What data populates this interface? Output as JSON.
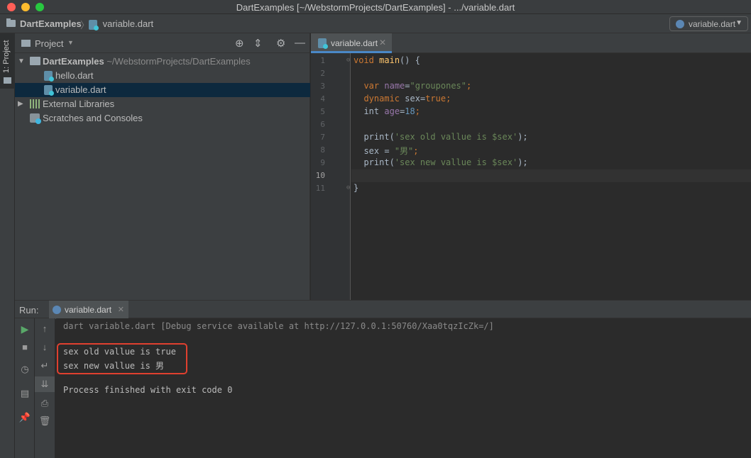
{
  "window": {
    "title": "DartExamples [~/WebstormProjects/DartExamples] - .../variable.dart"
  },
  "navbar": {
    "project": "DartExamples",
    "file": "variable.dart",
    "run_config": "variable.dart"
  },
  "left_strip": {
    "project_tab": "1: Project"
  },
  "project_panel": {
    "title": "Project",
    "tree": [
      {
        "label": "DartExamples",
        "path": "~/WebstormProjects/DartExamples"
      },
      {
        "label": "hello.dart"
      },
      {
        "label": "variable.dart",
        "selected": true
      },
      {
        "label": "External Libraries"
      },
      {
        "label": "Scratches and Consoles"
      }
    ]
  },
  "editor": {
    "tab": "variable.dart",
    "line_numbers": [
      "1",
      "2",
      "3",
      "4",
      "5",
      "6",
      "7",
      "8",
      "9",
      "10",
      "11"
    ],
    "current_line": "10",
    "code": {
      "l1_kw": "void",
      "l1_fn": "main",
      "l1_rest": "() {",
      "l3_kw": "var",
      "l3_name": "name",
      "l3_eq": "=",
      "l3_str": "\"groupones\"",
      "l3_end": ";",
      "l4_kw": "dynamic",
      "l4_name": "sex",
      "l4_eq": "=",
      "l4_val": "true",
      "l4_end": ";",
      "l5_kw": "int",
      "l5_name": "age",
      "l5_eq": "=",
      "l5_val": "18",
      "l5_end": ";",
      "l7_fn": "print(",
      "l7_str": "'sex old vallue is $sex'",
      "l7_end": ");",
      "l8_pre": "sex = ",
      "l8_str": "\"男\"",
      "l8_end": ";",
      "l9_fn": "print(",
      "l9_str": "'sex new vallue is $sex'",
      "l9_end": ");",
      "l11": "}"
    }
  },
  "run_panel": {
    "label": "Run:",
    "tab": "variable.dart",
    "console": {
      "command": "dart variable.dart [Debug service available at http://127.0.0.1:50760/Xaa0tqzIcZk=/]",
      "out1": "sex old vallue is true",
      "out2": "sex new vallue is 男",
      "exit": "Process finished with exit code 0"
    }
  },
  "colors": {
    "highlight_box": "#e0402f",
    "selection": "#0d293e",
    "tab_underline": "#4a88c7"
  }
}
